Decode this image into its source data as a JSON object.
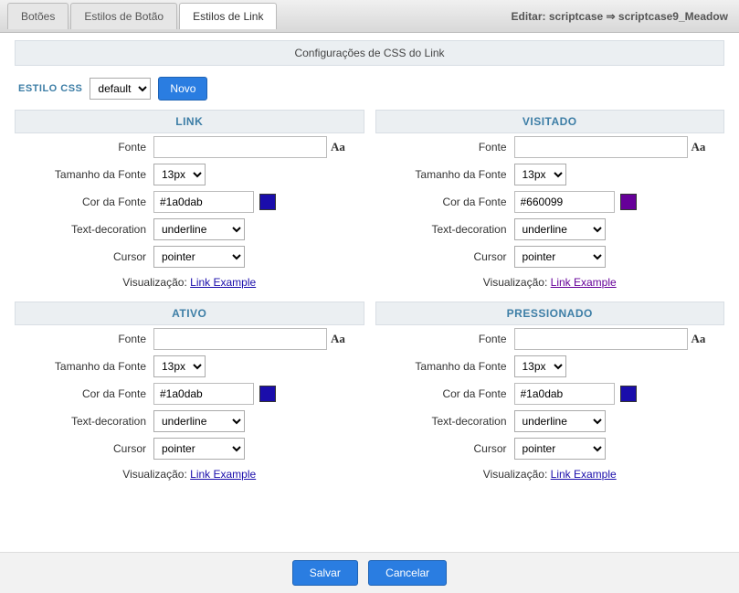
{
  "header": {
    "tabs": [
      "Botões",
      "Estilos de Botão",
      "Estilos de Link"
    ],
    "edit_label": "Editar: scriptcase ⇒ scriptcase9_Meadow"
  },
  "panel": {
    "title": "Configurações de CSS do Link",
    "style_css_label": "ESTILO CSS",
    "style_select_value": "default",
    "new_button": "Novo"
  },
  "labels": {
    "font": "Fonte",
    "font_size": "Tamanho da Fonte",
    "font_color": "Cor da Fonte",
    "text_decoration": "Text-decoration",
    "cursor": "Cursor",
    "preview": "Visualização:",
    "preview_link": "Link Example",
    "font_icon": "Aa"
  },
  "sections": {
    "link": {
      "title": "LINK",
      "font": "",
      "size": "13px",
      "color": "#1a0dab",
      "swatch": "#1a0dab",
      "decoration": "underline",
      "cursor": "pointer",
      "preview_class": ""
    },
    "visited": {
      "title": "VISITADO",
      "font": "",
      "size": "13px",
      "color": "#660099",
      "swatch": "#660099",
      "decoration": "underline",
      "cursor": "pointer",
      "preview_class": "visited"
    },
    "active": {
      "title": "ATIVO",
      "font": "",
      "size": "13px",
      "color": "#1a0dab",
      "swatch": "#1a0dab",
      "decoration": "underline",
      "cursor": "pointer",
      "preview_class": ""
    },
    "pressed": {
      "title": "PRESSIONADO",
      "font": "",
      "size": "13px",
      "color": "#1a0dab",
      "swatch": "#1a0dab",
      "decoration": "underline",
      "cursor": "pointer",
      "preview_class": ""
    }
  },
  "footer": {
    "save": "Salvar",
    "cancel": "Cancelar"
  }
}
